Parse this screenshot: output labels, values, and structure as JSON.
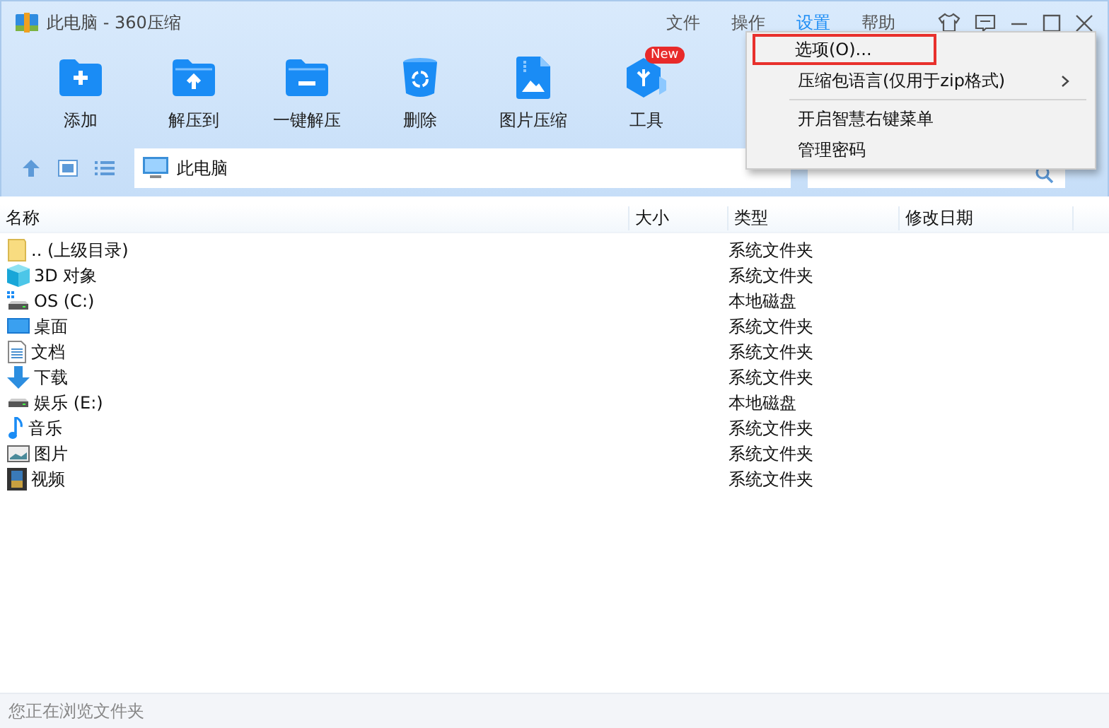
{
  "window": {
    "title": "此电脑 - 360压缩"
  },
  "menu_bar": [
    {
      "label": "文件",
      "selected": false
    },
    {
      "label": "操作",
      "selected": false
    },
    {
      "label": "设置",
      "selected": true
    },
    {
      "label": "帮助",
      "selected": false
    }
  ],
  "toolbar": [
    {
      "label": "添加",
      "kind": "add"
    },
    {
      "label": "解压到",
      "kind": "extract"
    },
    {
      "label": "一键解压",
      "kind": "oneclick"
    },
    {
      "label": "删除",
      "kind": "delete"
    },
    {
      "label": "图片压缩",
      "kind": "image"
    },
    {
      "label": "工具",
      "kind": "tools",
      "badge": "New"
    }
  ],
  "address": {
    "value": "此电脑"
  },
  "table": {
    "columns": [
      "名称",
      "大小",
      "类型",
      "修改日期"
    ],
    "rows": [
      {
        "name": ".. (上级目录)",
        "type": "系统文件夹",
        "kind": "up"
      },
      {
        "name": "3D 对象",
        "type": "系统文件夹",
        "kind": "cube"
      },
      {
        "name": "OS (C:)",
        "type": "本地磁盘",
        "kind": "osdrive"
      },
      {
        "name": "桌面",
        "type": "系统文件夹",
        "kind": "desktop"
      },
      {
        "name": "文档",
        "type": "系统文件夹",
        "kind": "document"
      },
      {
        "name": "下载",
        "type": "系统文件夹",
        "kind": "download"
      },
      {
        "name": "娱乐 (E:)",
        "type": "本地磁盘",
        "kind": "drive"
      },
      {
        "name": "音乐",
        "type": "系统文件夹",
        "kind": "music"
      },
      {
        "name": "图片",
        "type": "系统文件夹",
        "kind": "picture"
      },
      {
        "name": "视频",
        "type": "系统文件夹",
        "kind": "video"
      }
    ]
  },
  "settings_menu": [
    {
      "kind": "item",
      "label": "选项(O)...",
      "highlighted": true,
      "has_submenu": false
    },
    {
      "kind": "item",
      "label": "压缩包语言(仅用于zip格式)",
      "highlighted": false,
      "has_submenu": true
    },
    {
      "kind": "separator"
    },
    {
      "kind": "item",
      "label": "开启智慧右键菜单",
      "highlighted": false,
      "has_submenu": false
    },
    {
      "kind": "item",
      "label": "管理密码",
      "highlighted": false,
      "has_submenu": false
    }
  ],
  "status_bar": "您正在浏览文件夹"
}
